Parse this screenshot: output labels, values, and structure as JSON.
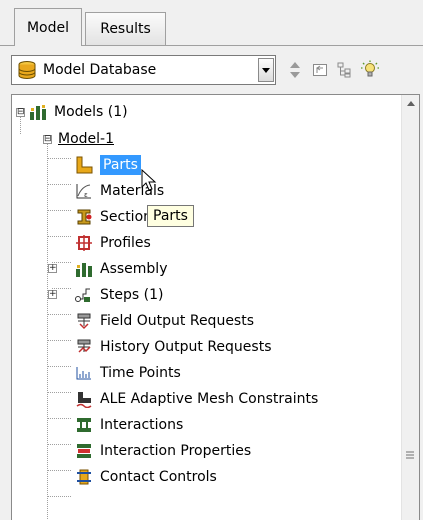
{
  "tabs": [
    {
      "label": "Model",
      "active": true
    },
    {
      "label": "Results",
      "active": false
    }
  ],
  "toolbar": {
    "database_selected": "Model Database",
    "icons": [
      "database-icon",
      "dropdown-arrow-icon",
      "updown-arrows-icon",
      "expand-tree-icon",
      "collapse-tree-icon",
      "lightbulb-icon"
    ]
  },
  "tree": {
    "root": {
      "label": "Models (1)",
      "expander": "⊟"
    },
    "model": {
      "label": "Model-1",
      "expander": "⊟"
    },
    "items": [
      {
        "label": "Parts",
        "icon": "parts-icon",
        "selected": true
      },
      {
        "label": "Materials",
        "icon": "materials-icon"
      },
      {
        "label": "Sections",
        "icon": "sections-icon"
      },
      {
        "label": "Profiles",
        "icon": "profiles-icon"
      },
      {
        "label": "Assembly",
        "icon": "assembly-icon",
        "expandable": true
      },
      {
        "label": "Steps (1)",
        "icon": "steps-icon",
        "expandable": true
      },
      {
        "label": "Field Output Requests",
        "icon": "field-output-icon"
      },
      {
        "label": "History Output Requests",
        "icon": "history-output-icon"
      },
      {
        "label": "Time Points",
        "icon": "time-points-icon"
      },
      {
        "label": "ALE Adaptive Mesh Constraints",
        "icon": "ale-mesh-icon"
      },
      {
        "label": "Interactions",
        "icon": "interactions-icon"
      },
      {
        "label": "Interaction Properties",
        "icon": "interaction-properties-icon"
      },
      {
        "label": "Contact Controls",
        "icon": "contact-controls-icon"
      }
    ],
    "tooltip": "Parts"
  },
  "colors": {
    "selection": "#3399ff",
    "tooltip_bg": "#ffffe1",
    "panel_bg": "#f0f0f0"
  }
}
